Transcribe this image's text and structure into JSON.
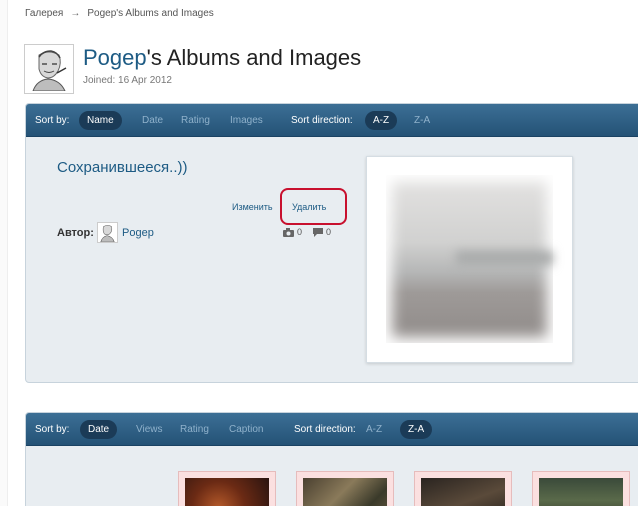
{
  "breadcrumb": {
    "gallery": "Галерея",
    "separator": "→",
    "current": "Pogep's Albums and Images"
  },
  "profile": {
    "username": "Pogep",
    "title_suffix": "'s Albums and Images",
    "joined": "Joined: 16 Apr 2012"
  },
  "sortbar1": {
    "sort_by_label": "Sort by:",
    "options": [
      "Name",
      "Date",
      "Rating",
      "Images"
    ],
    "selected": "Name",
    "direction_label": "Sort direction:",
    "directions": [
      "A-Z",
      "Z-A"
    ],
    "selected_direction": "A-Z"
  },
  "album": {
    "title": "Сохранившееся..))",
    "edit_label": "Изменить",
    "delete_label": "Удалить",
    "author_label": "Автор:",
    "author_name": "Pogep",
    "images_count": "0",
    "comments_count": "0"
  },
  "sortbar2": {
    "sort_by_label": "Sort by:",
    "options": [
      "Date",
      "Views",
      "Rating",
      "Caption"
    ],
    "selected": "Date",
    "direction_label": "Sort direction:",
    "directions": [
      "A-Z",
      "Z-A"
    ],
    "selected_direction": "Z-A"
  },
  "colors": {
    "accent": "#1d5b84",
    "bar": "#2b5b82",
    "pill": "#1b3b57",
    "highlight": "#c8102e"
  },
  "icons": [
    "camera-icon",
    "comment-bubble-icon"
  ]
}
